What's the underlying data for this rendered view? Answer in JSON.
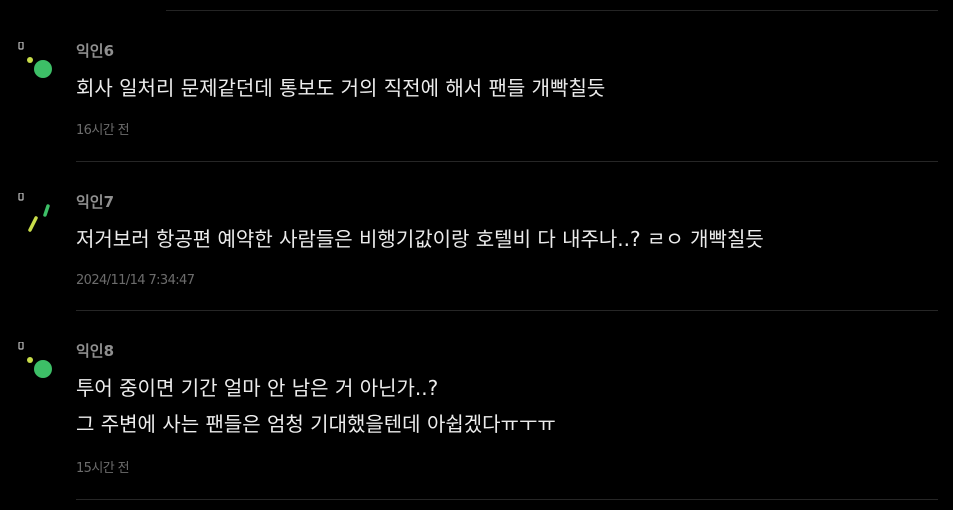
{
  "comments": [
    {
      "author": "익인6",
      "lines": [
        "회사 일처리 문제같던데 통보도 거의 직전에 해서 팬들 개빡칠듯"
      ],
      "time": "16시간 전",
      "avatar_icon": "dots-and-green-circle-icon"
    },
    {
      "author": "익인7",
      "lines": [
        "저거보러 항공편 예약한 사람들은 비행기값이랑 호텔비 다 내주나..? ㄹㅇ 개빡칠듯"
      ],
      "time": "2024/11/14 7:34:47",
      "avatar_icon": "yellow-green-slashes-icon"
    },
    {
      "author": "익인8",
      "lines": [
        "투어 중이면 기간 얼마 안 남은 거 아닌가..?",
        "그 주변에 사는 팬들은 엄청 기대했을텐데 아쉽겠다ㅠㅜㅠ"
      ],
      "time": "15시간 전",
      "avatar_icon": "dots-and-green-circle-icon"
    }
  ],
  "colors": {
    "background": "#000000",
    "text": "#ececec",
    "author": "#8f8f8f",
    "time": "#6c6c6c",
    "avatar_green": "#3dbf67",
    "avatar_yellow": "#c8dd4a"
  }
}
